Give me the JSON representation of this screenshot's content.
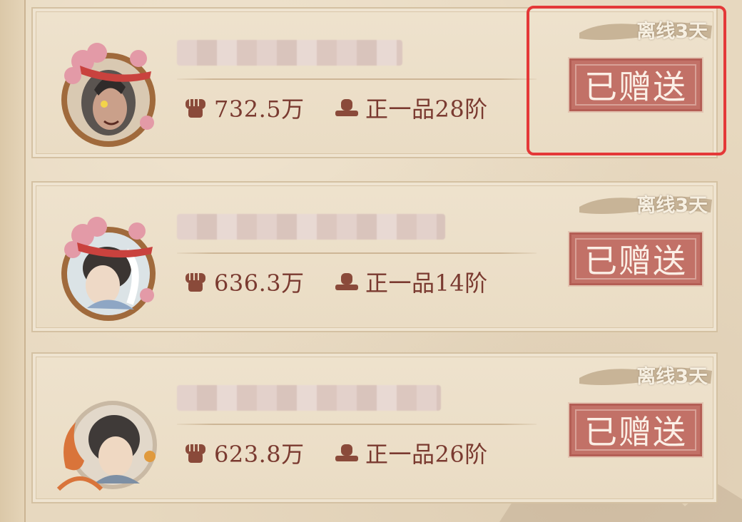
{
  "friends": [
    {
      "offline": "离线3天",
      "power_value": "732.5万",
      "rank": "正一品28阶",
      "status_label": "已赠送",
      "avatar": "warrior-portrait-with-flowers",
      "name_blur_width": 0
    },
    {
      "offline": "离线3天",
      "power_value": "636.3万",
      "rank": "正一品14阶",
      "status_label": "已赠送",
      "avatar": "lady-portrait-with-flowers"
    },
    {
      "offline": "离线3天",
      "power_value": "623.8万",
      "rank": "正一品26阶",
      "status_label": "已赠送",
      "avatar": "scholar-portrait-with-fox"
    }
  ],
  "icons": {
    "power": "fist-icon",
    "rank": "official-hat-icon"
  },
  "colors": {
    "stat_text": "#7a3a30",
    "stamp": "#c27167",
    "highlight": "#e43838",
    "offline_text": "#f7f0e2"
  }
}
